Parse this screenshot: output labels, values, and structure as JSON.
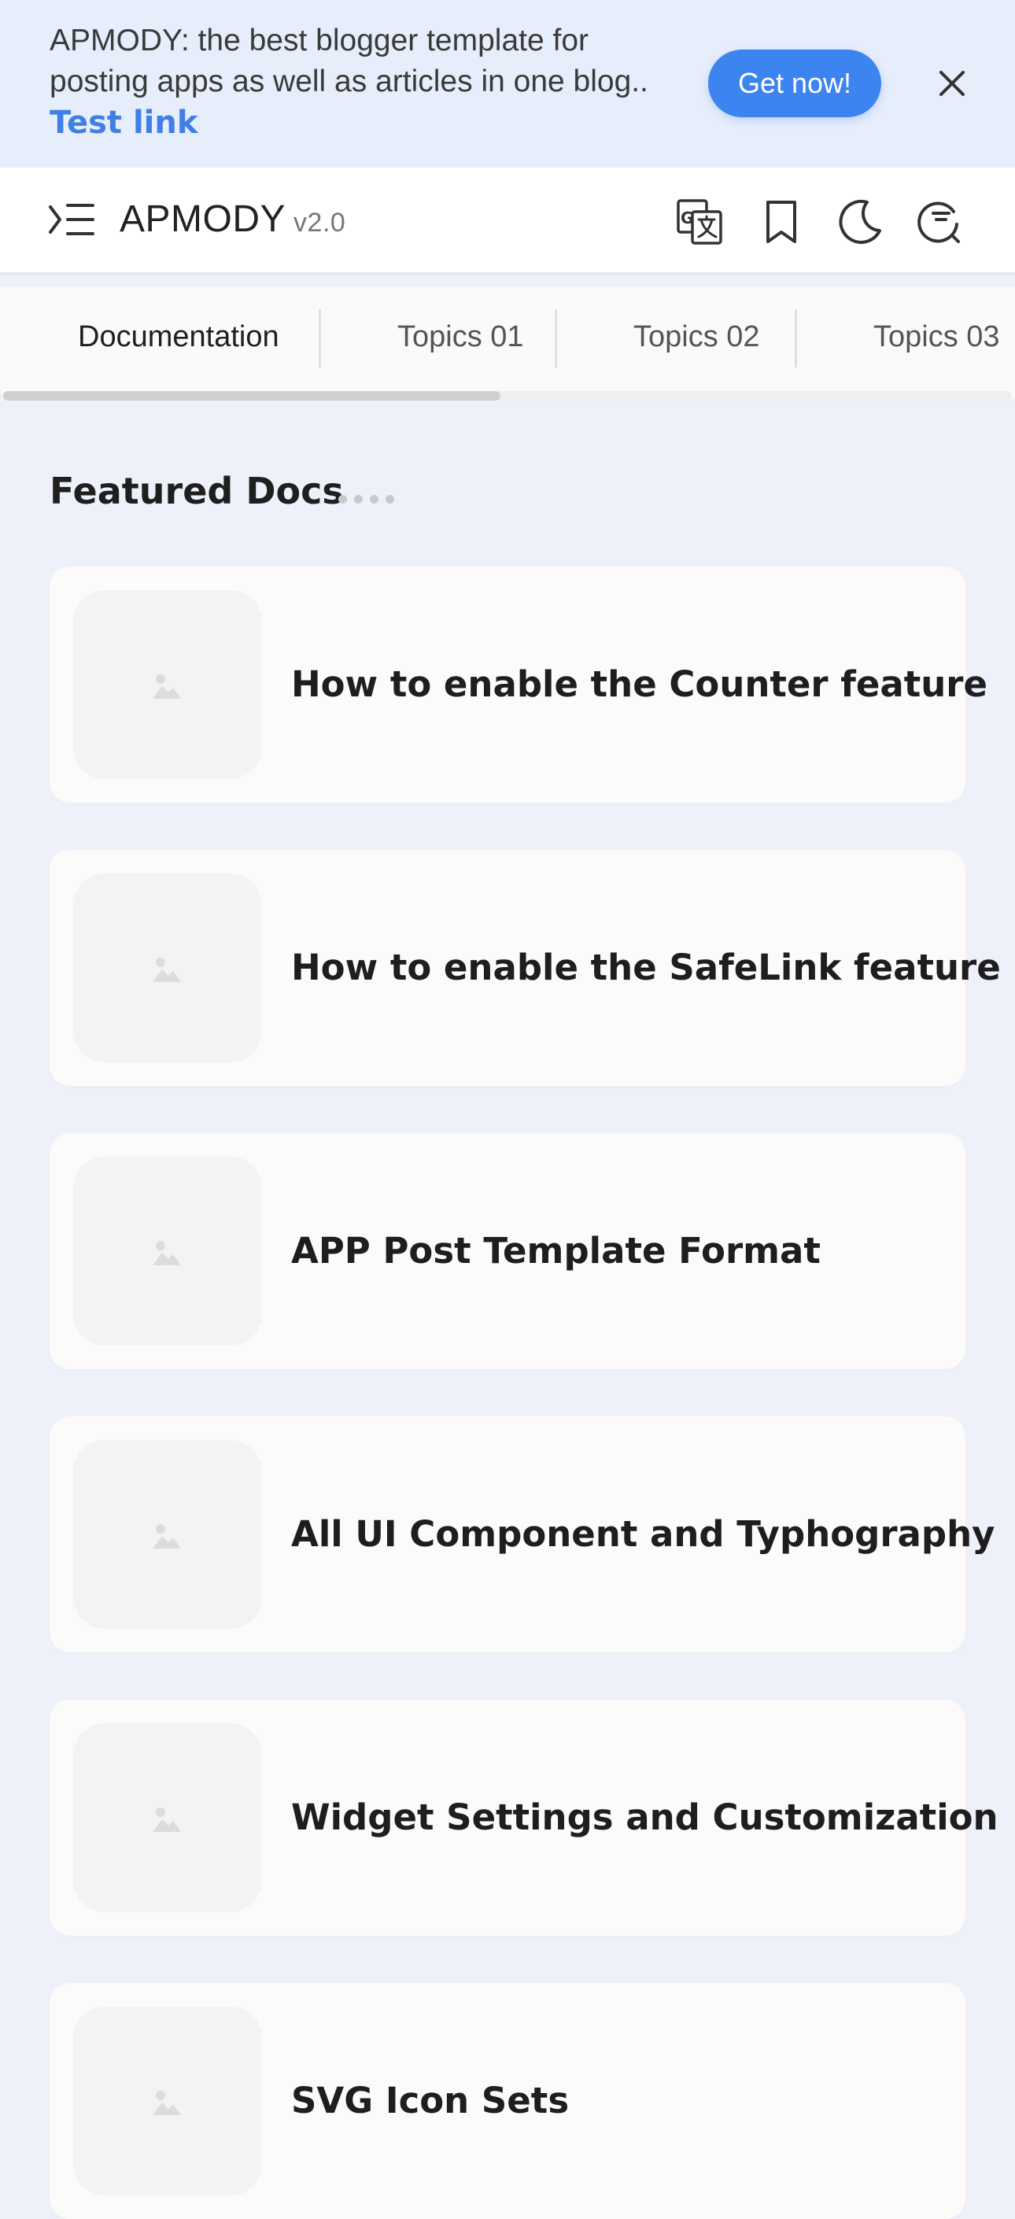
{
  "announcement": {
    "text": "APMODY: the best blogger template for posting apps as well as articles in one blog..",
    "link_label": "Test link",
    "cta_label": "Get now!",
    "close_icon": "close-icon"
  },
  "header": {
    "brand": "APMODY",
    "version": "v2.0",
    "icons": [
      "menu-icon",
      "translate-icon",
      "bookmark-icon",
      "dark-mode-icon",
      "search-icon"
    ]
  },
  "tabs": [
    {
      "label": "Documentation",
      "active": true
    },
    {
      "label": "Topics 01",
      "active": false
    },
    {
      "label": "Topics 02",
      "active": false
    },
    {
      "label": "Topics 03",
      "active": false
    }
  ],
  "section": {
    "title": "Featured Docs"
  },
  "cards": [
    {
      "title": "How to enable the Counter feature"
    },
    {
      "title": "How to enable the SafeLink feature"
    },
    {
      "title": "APP Post Template Format"
    },
    {
      "title": "All UI Component and Typhography"
    },
    {
      "title": "Widget Settings and Customization"
    },
    {
      "title": "SVG Icon Sets"
    }
  ],
  "colors": {
    "accent": "#3c84ef",
    "link": "#3f7fe6",
    "announce_bg": "#e6edfb",
    "page_bg": "#eef1fa",
    "card_bg": "#fcfbf9"
  }
}
